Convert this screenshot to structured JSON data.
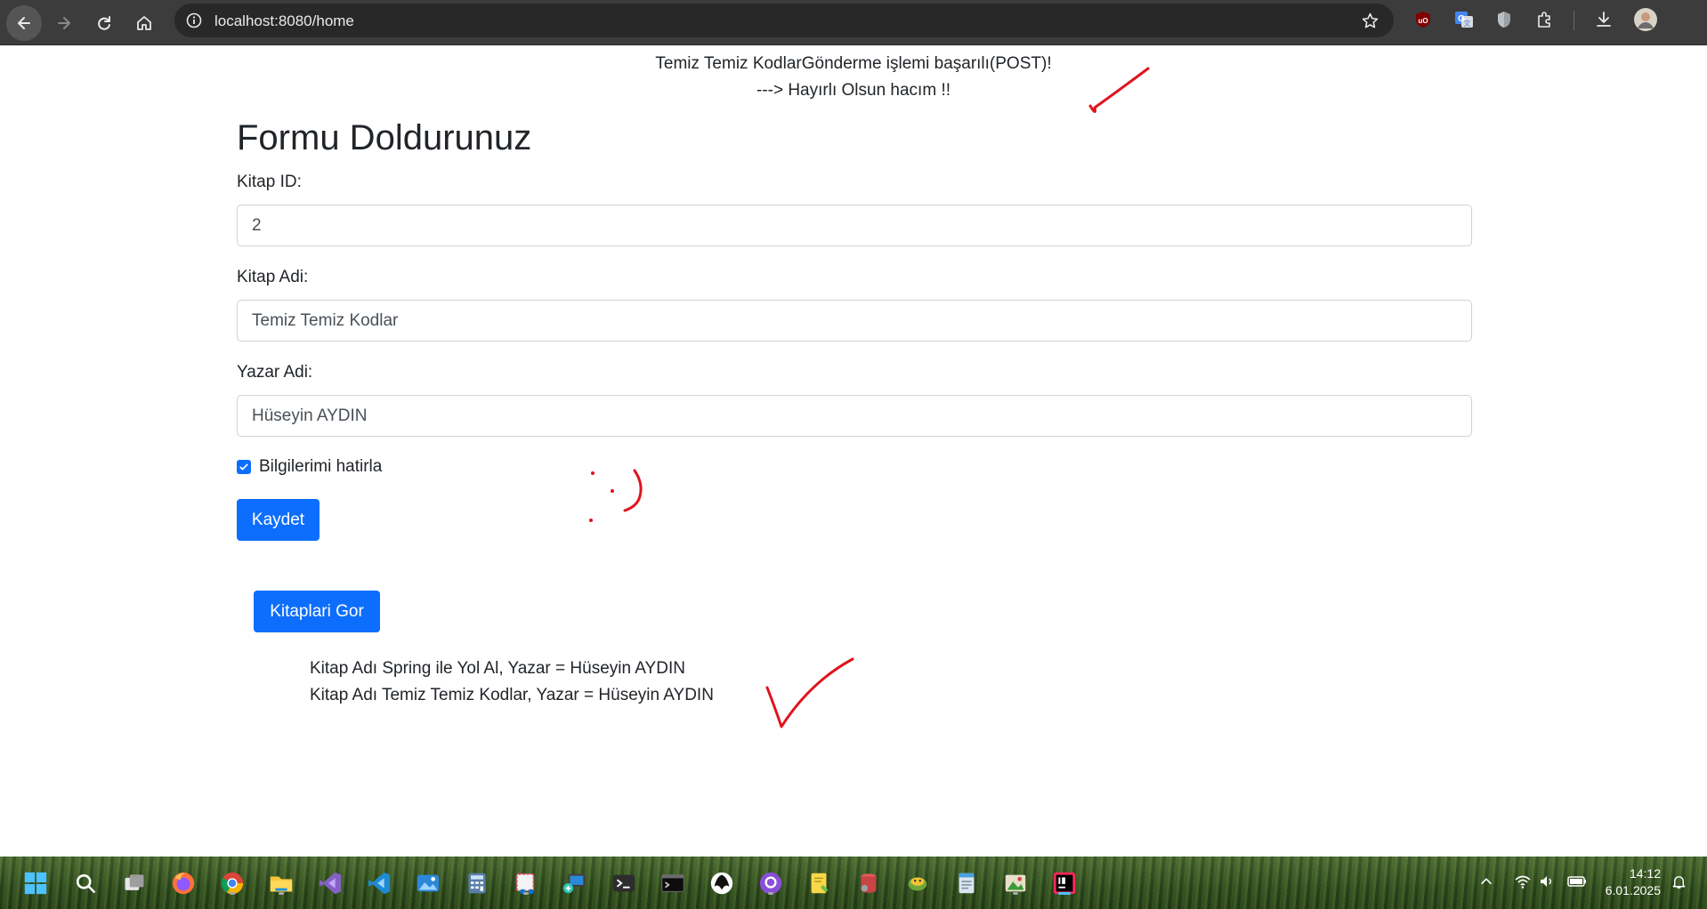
{
  "browser": {
    "url": "localhost:8080/home"
  },
  "page": {
    "success_line1": "Temiz Temiz KodlarGönderme işlemi başarılı(POST)!",
    "success_line2": "---> Hayırlı Olsun hacım !!",
    "form_title": "Formu Doldurunuz",
    "fields": [
      {
        "label": "Kitap ID:",
        "value": "2"
      },
      {
        "label": "Kitap Adi:",
        "value": "Temiz Temiz Kodlar"
      },
      {
        "label": "Yazar Adi:",
        "value": "Hüseyin AYDIN"
      }
    ],
    "remember_label": "Bilgilerimi hatirla",
    "remember_checked": true,
    "save_button": "Kaydet",
    "view_books_button": "Kitaplari Gor",
    "books": [
      "Kitap Adı Spring ile Yol Al, Yazar = Hüseyin AYDIN",
      "Kitap Adı Temiz Temiz Kodlar, Yazar = Hüseyin AYDIN"
    ],
    "annotation_color": "#e0141e"
  },
  "taskbar": {
    "time": "14:12",
    "date": "6.01.2025",
    "apps": [
      "start-icon",
      "search-icon",
      "task-view-icon",
      "firefox-icon",
      "chrome-icon",
      "file-explorer-icon",
      "visual-studio-icon",
      "vscode-icon",
      "photos-icon",
      "calculator-icon",
      "snipping-tool-icon",
      "remote-desktop-icon",
      "terminal-icon",
      "cmd-icon",
      "inkscape-icon",
      "github-desktop-icon",
      "notes-icon",
      "database-icon",
      "python-icon",
      "notepad-icon",
      "image-editor-icon",
      "intellij-icon"
    ]
  }
}
